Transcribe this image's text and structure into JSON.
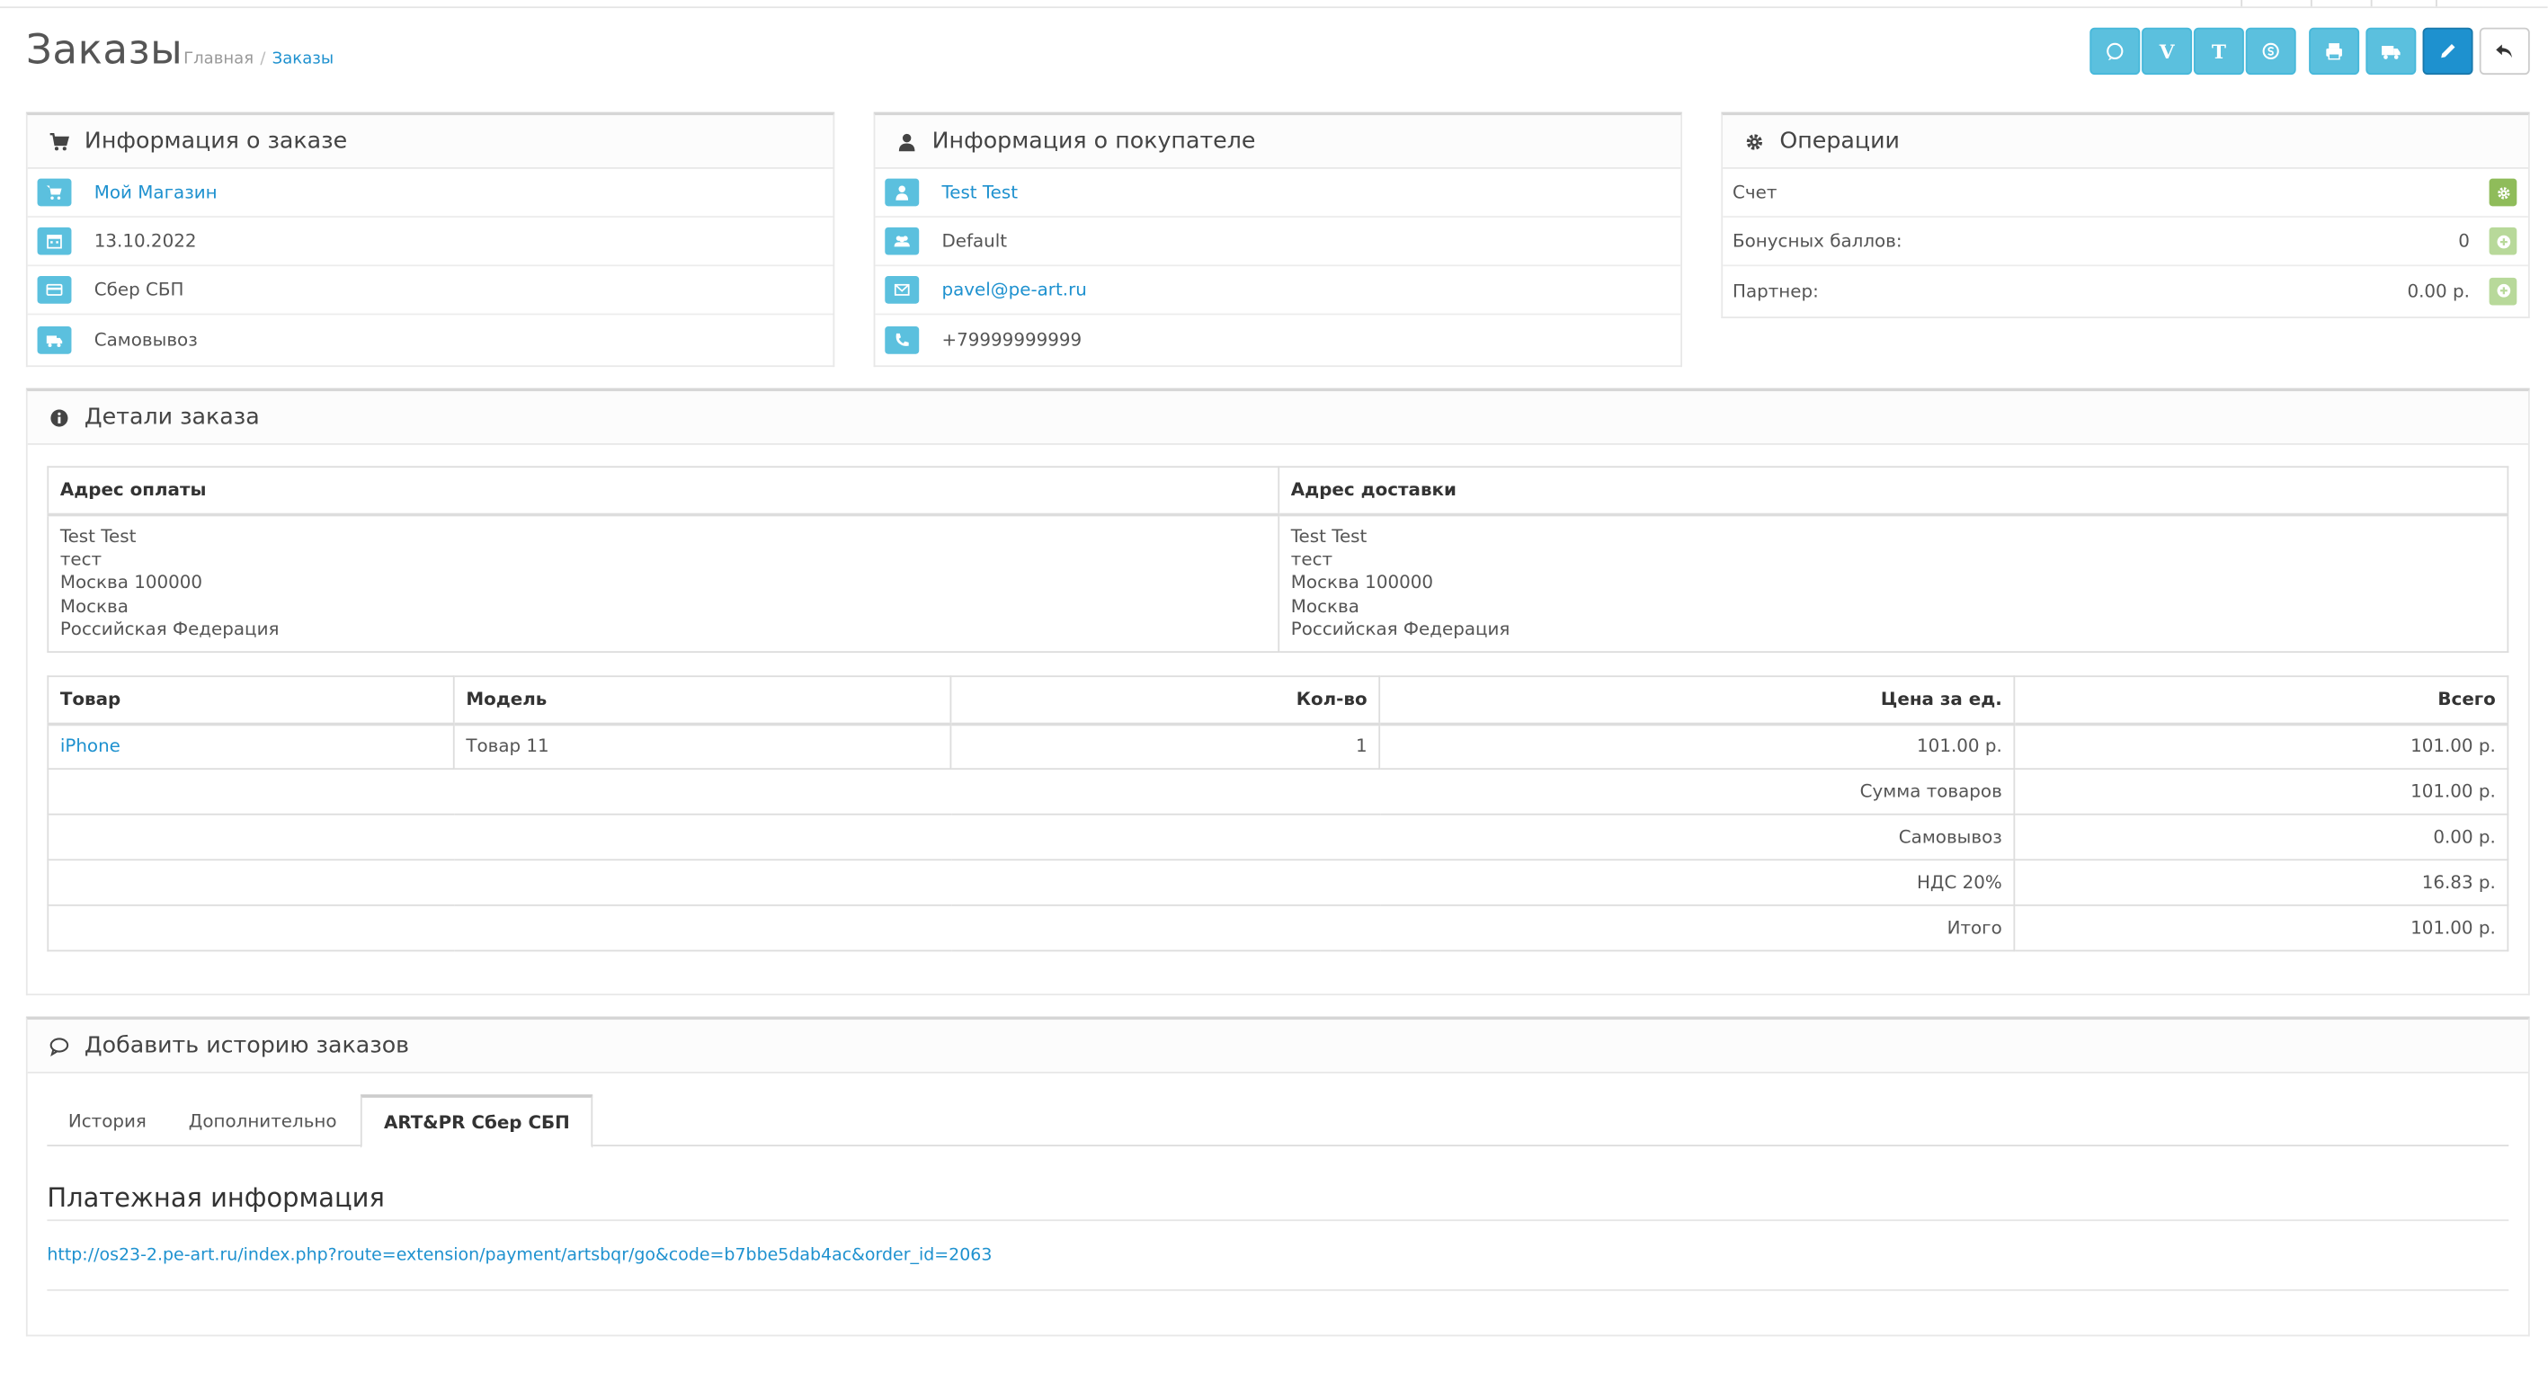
{
  "header": {
    "title": "Заказы",
    "breadcrumb": {
      "home": "Главная",
      "current": "Заказы"
    }
  },
  "toolbar": {
    "buttons": [
      {
        "icon": "whatsapp-icon",
        "label": ""
      },
      {
        "icon": "viber-icon",
        "label": "V"
      },
      {
        "icon": "telegram-icon",
        "label": "T"
      },
      {
        "icon": "skype-icon",
        "label": ""
      },
      {
        "icon": "print-icon",
        "label": ""
      },
      {
        "icon": "truck-icon",
        "label": ""
      },
      {
        "icon": "pencil-icon",
        "label": ""
      },
      {
        "icon": "reply-icon",
        "label": ""
      }
    ]
  },
  "order_info": {
    "title": "Информация о заказе",
    "store": "Мой Магазин",
    "date": "13.10.2022",
    "payment": "Сбер СБП",
    "shipping": "Самовывоз"
  },
  "customer_info": {
    "title": "Информация о покупателе",
    "name": "Test Test",
    "group": "Default",
    "email": "pavel@pe-art.ru",
    "phone": "+79999999999"
  },
  "operations": {
    "title": "Операции",
    "invoice_label": "Счет",
    "bonus_label": "Бонусных баллов:",
    "bonus_value": "0",
    "partner_label": "Партнер:",
    "partner_value": "0.00 р."
  },
  "order_details": {
    "title": "Детали заказа",
    "payment_address_header": "Адрес оплаты",
    "shipping_address_header": "Адрес доставки",
    "payment_address": [
      "Test Test",
      "тест",
      "Москва 100000",
      "Москва",
      "Российская Федерация"
    ],
    "shipping_address": [
      "Test Test",
      "тест",
      "Москва 100000",
      "Москва",
      "Российская Федерация"
    ],
    "columns": {
      "product": "Товар",
      "model": "Модель",
      "qty": "Кол-во",
      "price": "Цена за ед.",
      "total": "Всего"
    },
    "products": [
      {
        "name": "iPhone",
        "model": "Товар 11",
        "qty": "1",
        "price": "101.00 р.",
        "total": "101.00 р."
      }
    ],
    "totals": [
      {
        "label": "Сумма товаров",
        "value": "101.00 р."
      },
      {
        "label": "Самовывоз",
        "value": "0.00 р."
      },
      {
        "label": "НДС 20%",
        "value": "16.83 р."
      },
      {
        "label": "Итого",
        "value": "101.00 р."
      }
    ]
  },
  "history": {
    "title": "Добавить историю заказов",
    "tabs": [
      "История",
      "Дополнительно",
      "ART&PR Сбер СБП"
    ],
    "payment_info_title": "Платежная информация",
    "payment_link": "http://os23-2.pe-art.ru/index.php?route=extension/payment/artsbqr/go&code=b7bbe5dab4ac&order_id=2063"
  },
  "colors": {
    "info": "#5bc0de",
    "primary": "#1e91cf",
    "success": "#8fbc5a",
    "link": "#1e91cf"
  }
}
